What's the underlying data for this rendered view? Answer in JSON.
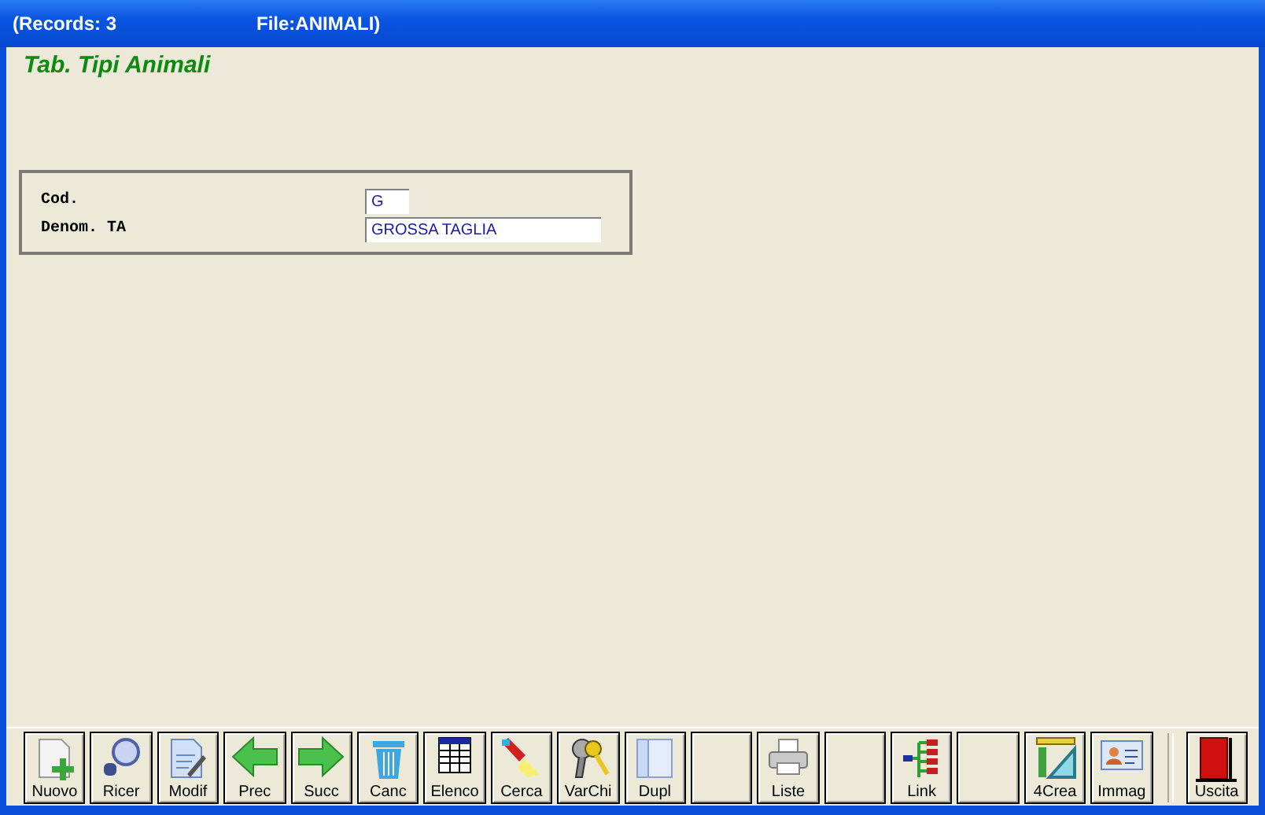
{
  "window": {
    "title_records": "(Records: 3",
    "title_file": "File:ANIMALI)"
  },
  "form": {
    "title": "Tab. Tipi Animali",
    "fields": [
      {
        "kind": "code",
        "label": "Cod.",
        "value": "G"
      },
      {
        "kind": "text",
        "label": "Denom. TA",
        "value": "GROSSA TAGLIA"
      }
    ]
  },
  "toolbar": [
    {
      "kind": "command",
      "label": "Nuovo"
    },
    {
      "kind": "command",
      "label": "Ricer"
    },
    {
      "kind": "command",
      "label": "Modif"
    },
    {
      "kind": "command",
      "label": "Prec"
    },
    {
      "kind": "command",
      "label": "Succ"
    },
    {
      "kind": "command",
      "label": "Canc"
    },
    {
      "kind": "command",
      "label": "Elenco"
    },
    {
      "kind": "command",
      "label": "Cerca"
    },
    {
      "kind": "command",
      "label": "VarChi"
    },
    {
      "kind": "command",
      "label": "Dupl"
    },
    {
      "kind": "blank"
    },
    {
      "kind": "command",
      "label": "Liste"
    },
    {
      "kind": "blank"
    },
    {
      "kind": "command",
      "label": "Link"
    },
    {
      "kind": "blank"
    },
    {
      "kind": "command",
      "label": "4Crea"
    },
    {
      "kind": "command",
      "label": "Immag"
    }
  ],
  "exit_button": {
    "label": "Uscita"
  }
}
